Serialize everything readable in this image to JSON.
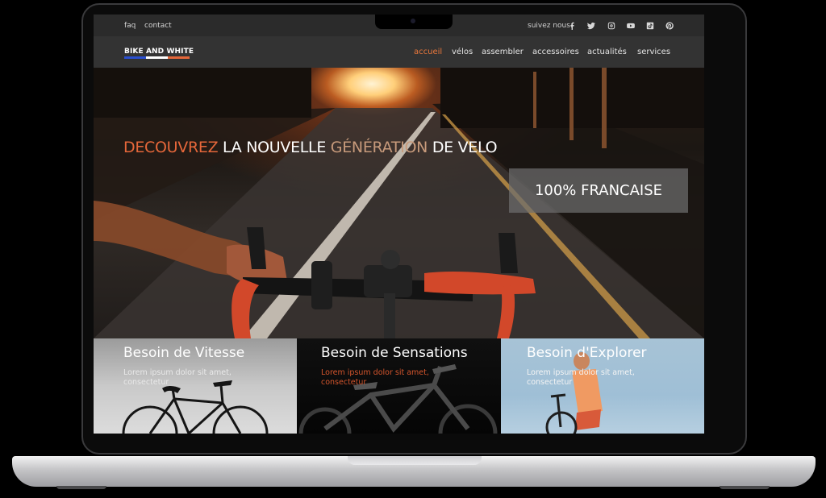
{
  "topbar": {
    "links": [
      "faq",
      "contact"
    ],
    "follow_label": "suivez nous:",
    "social_icons": [
      "facebook-icon",
      "twitter-icon",
      "instagram-icon",
      "youtube-icon",
      "tiktok-icon",
      "pinterest-icon"
    ]
  },
  "brand": {
    "logo_text": "BIKE AND WHITE",
    "logo_colors": [
      "#2a4fd0",
      "#ffffff",
      "#e5673a"
    ]
  },
  "nav": {
    "items": [
      "accueil",
      "vélos",
      "assembler",
      "accessoires",
      "actualités",
      "services"
    ],
    "active": "accueil"
  },
  "hero": {
    "headline_part1": "DECOUVREZ",
    "headline_part2": " LA NOUVELLE ",
    "headline_part3": "GÉNÉRATION",
    "headline_part4": " DE VELO",
    "badge": "100% FRANCAISE"
  },
  "cards": [
    {
      "title": "Besoin de Vitesse",
      "text": "Lorem ipsum dolor sit amet, consectetur"
    },
    {
      "title": "Besoin de Sensations",
      "text": "Lorem ipsum dolor sit amet, consectetur"
    },
    {
      "title": "Besoin d'Explorer",
      "text": "Lorem ipsum dolor sit amet, consectetur"
    }
  ],
  "colors": {
    "accent": "#e8773c",
    "topbar": "#2b2b2b",
    "navbar": "#333333",
    "badge_bg": "#6e6e6e"
  }
}
